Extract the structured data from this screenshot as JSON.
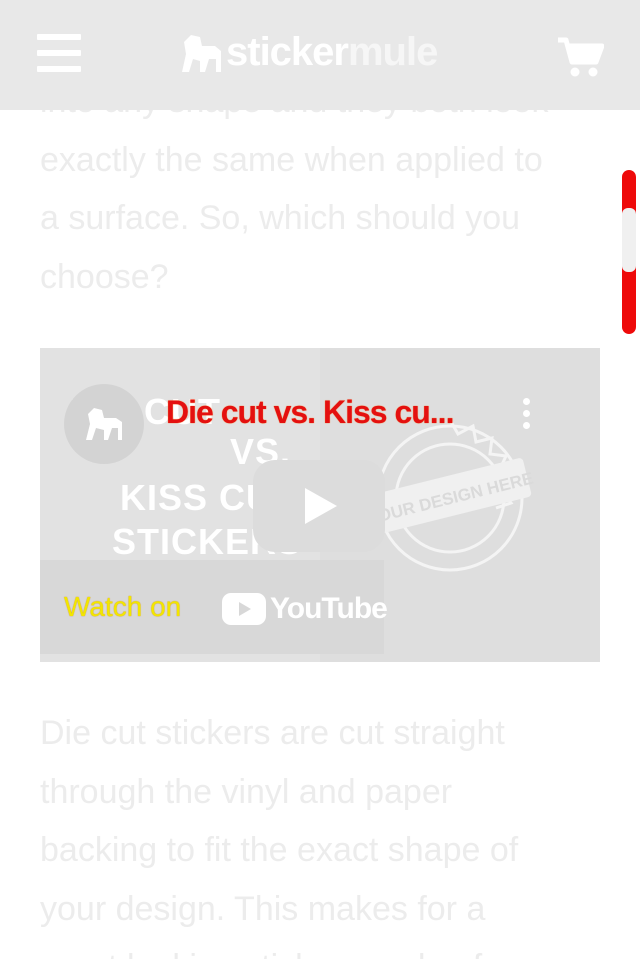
{
  "header": {
    "logo_primary": "sticker",
    "logo_secondary": "mule",
    "menu_icon": "hamburger-menu-icon",
    "cart_icon": "shopping-cart-icon",
    "background_color": "#e8e8e8"
  },
  "article": {
    "intro_lines": [
      "into any shape and they both look",
      "exactly the same when applied to",
      "a surface. So, which should you",
      "choose?"
    ],
    "body_lines": [
      "Die cut stickers are cut straight",
      "through the vinyl and paper",
      "backing to fit the exact shape of",
      "your design. This makes for a",
      "great looking sticker, made of"
    ],
    "text_color": "#ececec"
  },
  "video": {
    "title": "Die cut vs. Kiss cu...",
    "thumbnail_lines": [
      "DIE CUT",
      "VS.",
      "KISS CUT",
      "STICKERS"
    ],
    "badge_text": "YOUR DESIGN HERE",
    "watch_label": "Watch on",
    "youtube_label": "YouTube",
    "title_color": "#e41010",
    "watch_color": "#f2e600"
  },
  "scrollbar": {
    "color": "#ee0a0a"
  }
}
